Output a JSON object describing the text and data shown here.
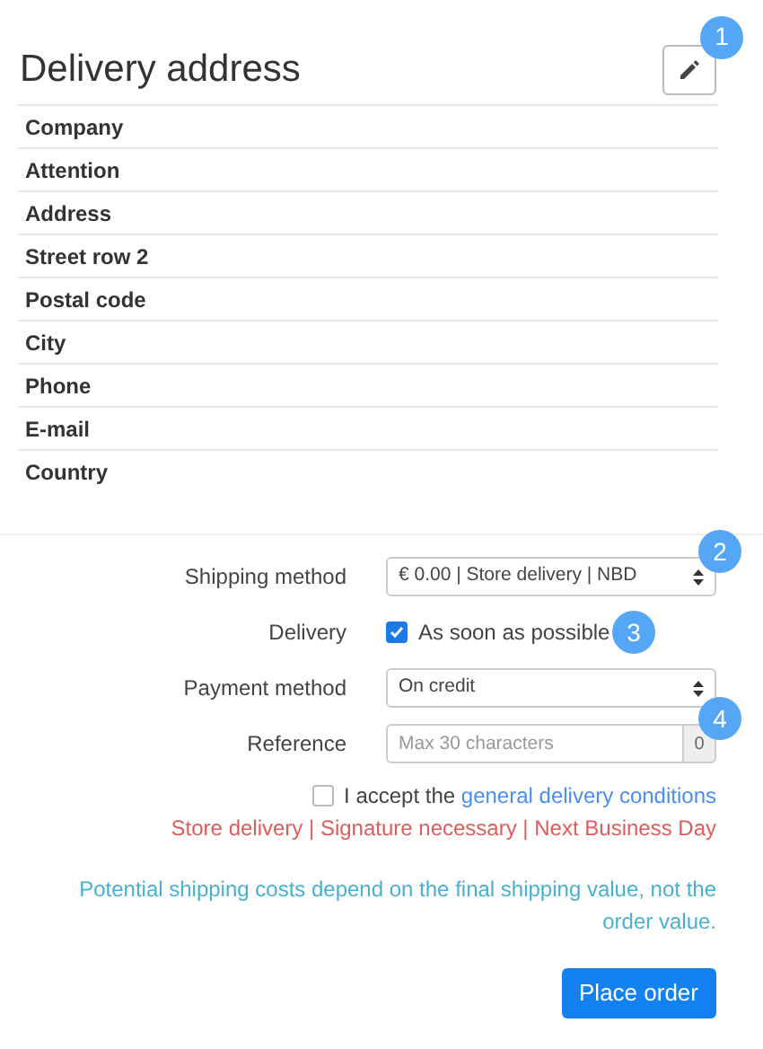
{
  "title": "Delivery address",
  "edit_button": {
    "badge": "1"
  },
  "address_fields": [
    "Company",
    "Attention",
    "Address",
    "Street row 2",
    "Postal code",
    "City",
    "Phone",
    "E-mail",
    "Country"
  ],
  "form": [
    {
      "kind": "select",
      "label": "Shipping method",
      "value": "€ 0.00 | Store delivery | NBD",
      "badge": "2"
    },
    {
      "kind": "checkbox",
      "label": "Delivery",
      "option": "As soon as possible",
      "checked": true,
      "badge": "3"
    },
    {
      "kind": "select",
      "label": "Payment method",
      "value": "On credit"
    },
    {
      "kind": "text",
      "label": "Reference",
      "placeholder": "Max 30 characters",
      "counter": "0",
      "badge": "4"
    }
  ],
  "accept": {
    "checked": false,
    "text": "I accept the ",
    "link": "general delivery conditions"
  },
  "shipping_summary": "Store delivery | Signature necessary | Next Business Day",
  "note": "Potential shipping costs depend on the final shipping value, not the order value.",
  "submit": "Place order"
}
